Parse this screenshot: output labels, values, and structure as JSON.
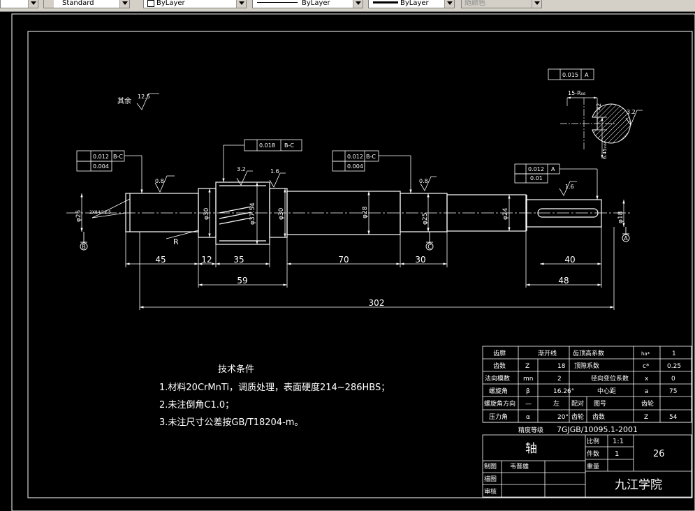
{
  "toolbar": {
    "text_style": "Standard",
    "layer": "ByLayer",
    "linetype": "ByLayer",
    "lineweight": "ByLayer",
    "plotstyle": "随颜色"
  },
  "drawing": {
    "other_surfaces_label": "其余",
    "other_roughness": "12.5",
    "roughness": [
      "0.8",
      "3.2",
      "1.6",
      "0.8",
      "1.6",
      "3.2"
    ],
    "fcf_left_1": "0.012",
    "fcf_left_1_datum": "B-C",
    "fcf_left_2": "0.004",
    "fcf_gear": "0.018",
    "fcf_gear_datum": "B-C",
    "fcf_mid_1": "0.012",
    "fcf_mid_1_datum": "B-C",
    "fcf_mid_2": "0.004",
    "fcf_right_1": "0.012",
    "fcf_right_1_datum": "A",
    "fcf_right_2": "0.01",
    "fcf_key": "0.015",
    "fcf_key_datum": "A",
    "key_width": "15-R₀₈",
    "key_depth_tag": "42",
    "key_bottom_dim": "6.45ₘ₆₉",
    "key_roughness": "3.2",
    "dia_left": "φ25",
    "chamfer": "2X84/12.5",
    "dia_30a": "φ30",
    "dia_gear": "φ37.54",
    "dia_30b": "φ30",
    "dia_28": "φ28",
    "dia_25b": "φ25",
    "dia_24": "φ24",
    "dia_18": "φ18",
    "fillet": "R",
    "datum_b": "B",
    "datum_c": "C",
    "datum_a": "A",
    "len": [
      "45",
      "12",
      "35",
      "70",
      "30",
      "40",
      "59",
      "48",
      "302"
    ]
  },
  "notes": {
    "title": "技术条件",
    "items": [
      "1.材料20CrMnTi，调质处理，表面硬度214~286HBS；",
      "2.未注倒角C1.0；",
      "3.未注尺寸公差按GB/T18204-m。"
    ]
  },
  "gear_table": {
    "rows": [
      [
        "齿廓",
        "渐开线",
        "齿顶高系数",
        "ha*",
        "1"
      ],
      [
        "齿数",
        "Z",
        "18",
        "顶隙系数",
        "c*",
        "0.25"
      ],
      [
        "法向模数",
        "mn",
        "2",
        "径向变位系数",
        "x",
        "0"
      ],
      [
        "螺旋角",
        "β",
        "16.26°",
        "中心距",
        "a",
        "75"
      ],
      [
        "螺旋角方向",
        "—",
        "左",
        "配对",
        "图号",
        "齿轮"
      ],
      [
        "压力角",
        "α",
        "20°",
        "齿轮",
        "齿数",
        "Z",
        "54"
      ]
    ],
    "precision_label": "精度等级",
    "precision_value": "7GJGB/10095.1-2001"
  },
  "title_block": {
    "part_name": "轴",
    "scale_label": "比例",
    "scale_value": "1:1",
    "qty_label": "件数",
    "qty_value": "1",
    "weight_label": "重量",
    "drawing_no": "26",
    "designer_label": "制图",
    "designer": "韦晋雄",
    "drafter_label": "描图",
    "checker_label": "审核",
    "school": "九江学院"
  }
}
